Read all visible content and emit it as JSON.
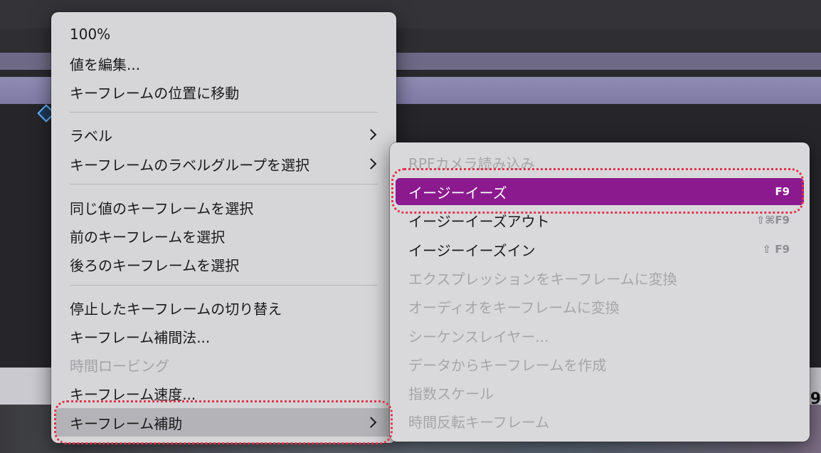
{
  "main_menu": {
    "items": [
      {
        "label": "100%",
        "disabled": false
      },
      {
        "label": "値を編集...",
        "disabled": false
      },
      {
        "label": "キーフレームの位置に移動",
        "disabled": false
      },
      {
        "label": "ラベル",
        "disabled": false,
        "submenu": true
      },
      {
        "label": "キーフレームのラベルグループを選択",
        "disabled": false,
        "submenu": true
      },
      {
        "label": "同じ値のキーフレームを選択",
        "disabled": false
      },
      {
        "label": "前のキーフレームを選択",
        "disabled": false
      },
      {
        "label": "後ろのキーフレームを選択",
        "disabled": false
      },
      {
        "label": "停止したキーフレームの切り替え",
        "disabled": false
      },
      {
        "label": "キーフレーム補間法...",
        "disabled": false
      },
      {
        "label": "時間ロービング",
        "disabled": true
      },
      {
        "label": "キーフレーム速度...",
        "disabled": false
      },
      {
        "label": "キーフレーム補助",
        "disabled": false,
        "submenu": true
      }
    ]
  },
  "sub_menu": {
    "items": [
      {
        "label": "RPFカメラ読み込み",
        "disabled": true,
        "shortcut": ""
      },
      {
        "label": "イージーイーズ",
        "disabled": false,
        "shortcut": "F9",
        "selected": true
      },
      {
        "label": "イージーイーズアウト",
        "disabled": false,
        "shortcut": "⇧⌘F9"
      },
      {
        "label": "イージーイーズイン",
        "disabled": false,
        "shortcut": "⇧ F9"
      },
      {
        "label": "エクスプレッションをキーフレームに変換",
        "disabled": true,
        "shortcut": ""
      },
      {
        "label": "オーディオをキーフレームに変換",
        "disabled": true,
        "shortcut": ""
      },
      {
        "label": "シーケンスレイヤー...",
        "disabled": true,
        "shortcut": ""
      },
      {
        "label": "データからキーフレームを作成",
        "disabled": true,
        "shortcut": ""
      },
      {
        "label": "指数スケール",
        "disabled": true,
        "shortcut": ""
      },
      {
        "label": "時間反転キーフレーム",
        "disabled": true,
        "shortcut": ""
      }
    ]
  },
  "background": {
    "edge_text": "9"
  },
  "colors": {
    "highlight": "#8a1a8e",
    "annotation": "#e0364a",
    "menu_bg": "#d6d6d8"
  }
}
